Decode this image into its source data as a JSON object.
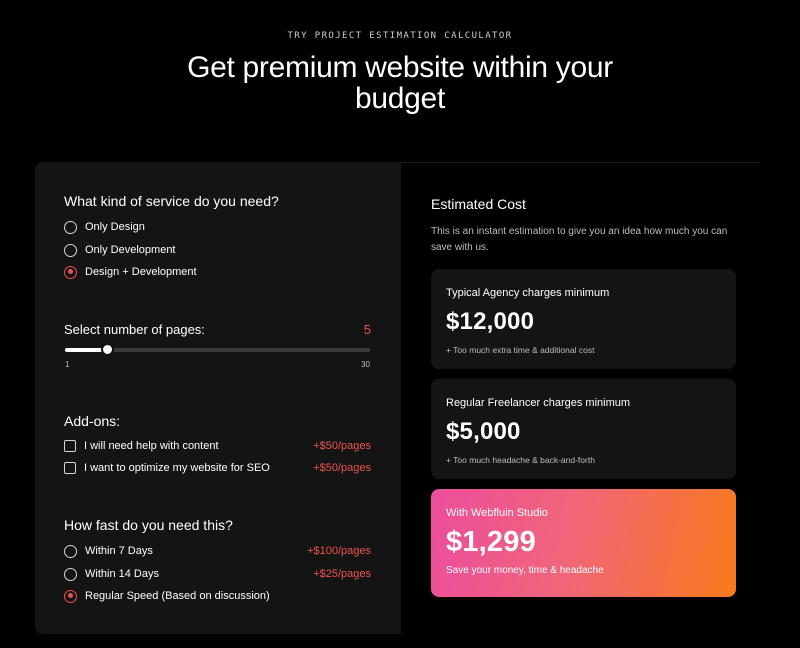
{
  "header": {
    "eyebrow": "TRY PROJECT ESTIMATION CALCULATOR",
    "title": "Get premium website within your budget"
  },
  "service": {
    "title": "What kind of service do you need?",
    "options": [
      {
        "label": "Only Design",
        "selected": false
      },
      {
        "label": "Only Development",
        "selected": false
      },
      {
        "label": "Design + Development",
        "selected": true
      }
    ]
  },
  "pages": {
    "title": "Select number of pages:",
    "value": "5",
    "min": "1",
    "max": "30",
    "current": 5
  },
  "addons": {
    "title": "Add-ons:",
    "items": [
      {
        "label": "I will need help with content",
        "price": "+$50/pages",
        "checked": false
      },
      {
        "label": "I want to optimize my website for SEO",
        "price": "+$50/pages",
        "checked": false
      }
    ]
  },
  "speed": {
    "title": "How fast do you need this?",
    "options": [
      {
        "label": "Within 7 Days",
        "price": "+$100/pages",
        "selected": false
      },
      {
        "label": "Within 14 Days",
        "price": "+$25/pages",
        "selected": false
      },
      {
        "label": "Regular Speed (Based on discussion)",
        "price": "",
        "selected": true
      }
    ]
  },
  "estimate": {
    "title": "Estimated Cost",
    "description": "This is an instant estimation to give you an idea how much you can save with us.",
    "agency": {
      "title": "Typical Agency charges minimum",
      "amount": "$12,000",
      "note": "+ Too much extra time & additional cost"
    },
    "freelancer": {
      "title": "Regular Freelancer charges minimum",
      "amount": "$5,000",
      "note": "+ Too much headache & back-and-forth"
    },
    "studio": {
      "title": "With Webfluin Studio",
      "amount": "$1,299",
      "note": "Save your money, time & headache"
    }
  },
  "colors": {
    "accent": "#ef5350",
    "gradient_start": "#ec4d9c",
    "gradient_end": "#f97a1c"
  }
}
